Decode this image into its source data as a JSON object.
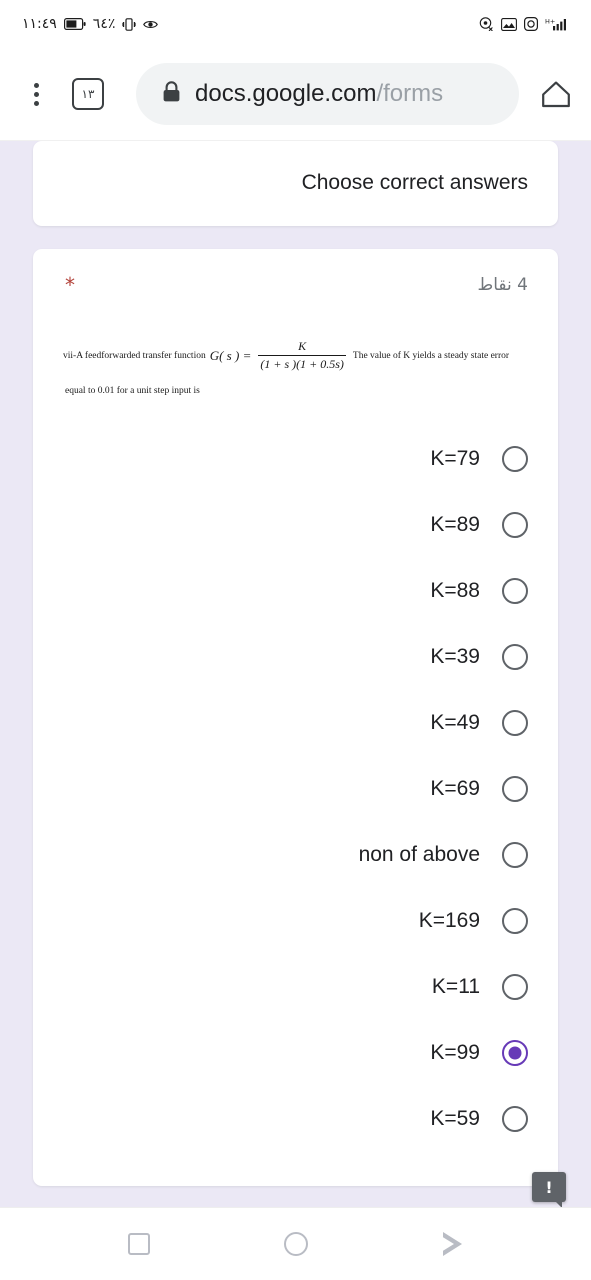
{
  "status_bar": {
    "time": "١١:٤٩",
    "battery_percent": "٦٤٪",
    "icons_left": [
      "battery-icon",
      "vibrate-icon",
      "eye-care-icon"
    ],
    "icons_right": [
      "location-off-icon",
      "photo-icon",
      "camera-icon",
      "signal-hplus-icon"
    ],
    "network_label": "H+"
  },
  "browser": {
    "menu_icon": "more-vert-icon",
    "tab_count": "١٣",
    "lock_icon": "lock-icon",
    "url_domain": "docs.google.com",
    "url_path": "/forms",
    "home_icon": "home-icon"
  },
  "form": {
    "header_title": "Choose correct answers",
    "question": {
      "points_label": "4 نقاط",
      "required_marker": "*",
      "prompt_prefix": "vii-A feedforwarded transfer function",
      "function_label": "G( s ) =",
      "fraction_numerator": "K",
      "fraction_denominator": "(1 + s )(1 + 0.5s)",
      "prompt_suffix": "The value of K yields a steady state error",
      "prompt_line2": "equal to 0.01 for a unit step input is",
      "options": [
        {
          "label": "K=79",
          "selected": false
        },
        {
          "label": "K=89",
          "selected": false
        },
        {
          "label": "K=88",
          "selected": false
        },
        {
          "label": "K=39",
          "selected": false
        },
        {
          "label": "K=49",
          "selected": false
        },
        {
          "label": "K=69",
          "selected": false
        },
        {
          "label": "non of above",
          "selected": false
        },
        {
          "label": "K=169",
          "selected": false
        },
        {
          "label": "K=11",
          "selected": false
        },
        {
          "label": "K=99",
          "selected": true
        },
        {
          "label": "K=59",
          "selected": false
        }
      ]
    },
    "warning_bubble": "!"
  },
  "nav_bar": {
    "recents_icon": "square-recents-icon",
    "home_icon": "circle-home-icon",
    "back_icon": "triangle-back-icon"
  },
  "colors": {
    "page_background": "#ebe8f5",
    "accent_purple": "#673ab7",
    "required_red": "#b3443b",
    "text_primary": "#202124",
    "text_secondary": "#70757a"
  }
}
